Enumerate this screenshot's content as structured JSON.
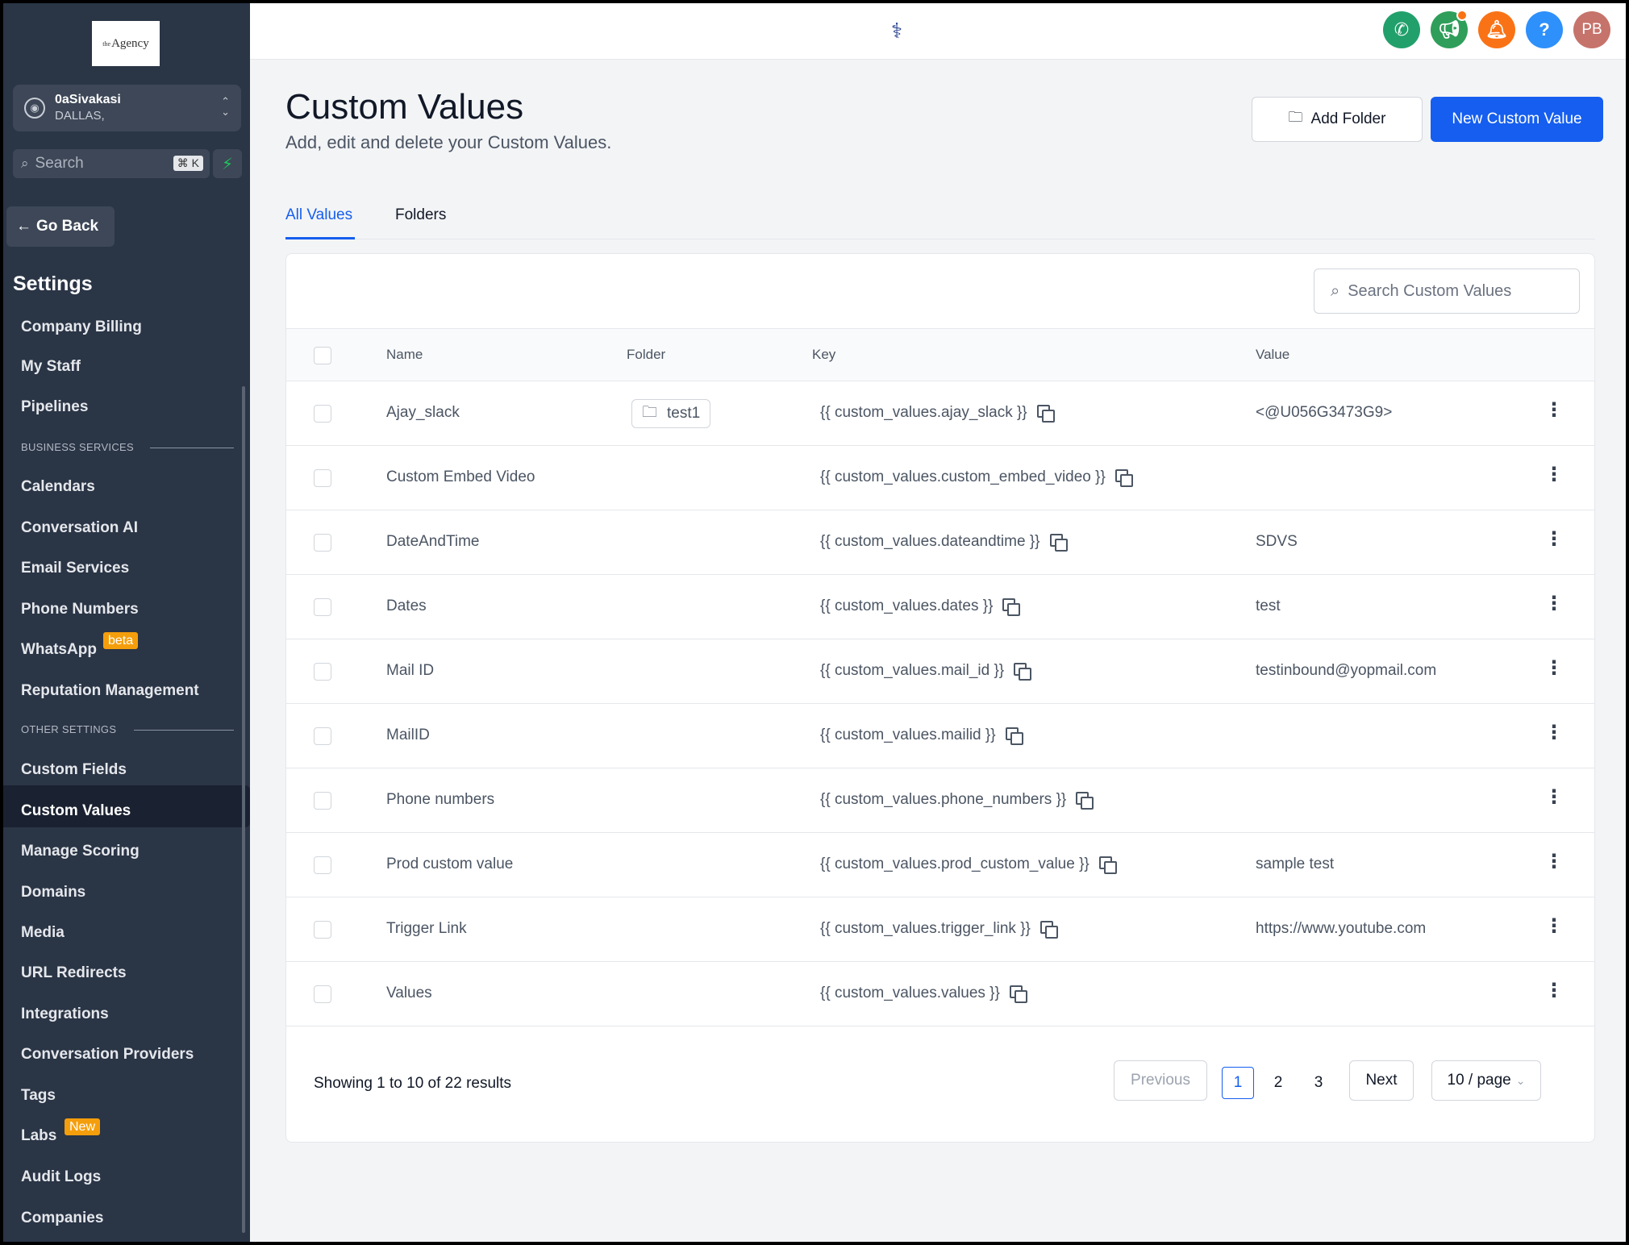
{
  "sidebar": {
    "logo_text": "Agency",
    "logo_sup": "the",
    "location": {
      "name": "0aSivakasi",
      "city": "DALLAS,"
    },
    "search": {
      "placeholder": "Search",
      "shortcut": "⌘ K"
    },
    "go_back": "Go Back",
    "title": "Settings",
    "items_top": [
      "Company Billing",
      "My Staff",
      "Pipelines"
    ],
    "section_business": "BUSINESS SERVICES",
    "items_business": [
      "Calendars",
      "Conversation AI",
      "Email Services",
      "Phone Numbers",
      "WhatsApp",
      "Reputation Management"
    ],
    "whatsapp_badge": "beta",
    "section_other": "OTHER SETTINGS",
    "items_other": [
      "Custom Fields",
      "Custom Values",
      "Manage Scoring",
      "Domains",
      "Media",
      "URL Redirects",
      "Integrations",
      "Conversation Providers",
      "Tags",
      "Labs",
      "Audit Logs",
      "Companies"
    ],
    "labs_badge": "New",
    "active_item": "Custom Values"
  },
  "topbar": {
    "avatar_initials": "PB",
    "help_label": "?",
    "colors": {
      "phone": "#22a06b",
      "megaphone": "#2f9e5a",
      "bell": "#f97316",
      "help": "#2e90fa",
      "avatar": "#c6736b"
    }
  },
  "header": {
    "title": "Custom Values",
    "subtitle": "Add, edit and delete your Custom Values.",
    "add_folder": "Add Folder",
    "new_value": "New Custom Value"
  },
  "tabs": [
    {
      "label": "All Values",
      "active": true
    },
    {
      "label": "Folders",
      "active": false
    }
  ],
  "table": {
    "search_placeholder": "Search Custom Values",
    "columns": [
      "Name",
      "Folder",
      "Key",
      "Value"
    ],
    "rows": [
      {
        "name": "Ajay_slack",
        "folder": "test1",
        "key": "{{ custom_values.ajay_slack }}",
        "value": "<@U056G3473G9>"
      },
      {
        "name": "Custom Embed Video",
        "folder": "",
        "key": "{{ custom_values.custom_embed_video }}",
        "value": ""
      },
      {
        "name": "DateAndTime",
        "folder": "",
        "key": "{{ custom_values.dateandtime }}",
        "value": "SDVS"
      },
      {
        "name": "Dates",
        "folder": "",
        "key": "{{ custom_values.dates }}",
        "value": "test"
      },
      {
        "name": "Mail ID",
        "folder": "",
        "key": "{{ custom_values.mail_id }}",
        "value": "testinbound@yopmail.com"
      },
      {
        "name": "MailID",
        "folder": "",
        "key": "{{ custom_values.mailid }}",
        "value": ""
      },
      {
        "name": "Phone numbers",
        "folder": "",
        "key": "{{ custom_values.phone_numbers }}",
        "value": ""
      },
      {
        "name": "Prod custom value",
        "folder": "",
        "key": "{{ custom_values.prod_custom_value }}",
        "value": "sample test"
      },
      {
        "name": "Trigger Link",
        "folder": "",
        "key": "{{ custom_values.trigger_link }}",
        "value": "https://www.youtube.com"
      },
      {
        "name": "Values",
        "folder": "",
        "key": "{{ custom_values.values }}",
        "value": ""
      }
    ]
  },
  "pagination": {
    "showing": "Showing 1 to 10 of 22 results",
    "previous": "Previous",
    "pages": [
      "1",
      "2",
      "3"
    ],
    "current_page": "1",
    "next": "Next",
    "per_page": "10 / page"
  }
}
